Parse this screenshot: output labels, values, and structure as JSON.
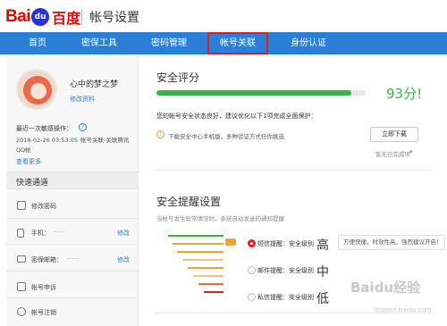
{
  "header": {
    "logo_latin": "Bai",
    "logo_paw": "du",
    "logo_cn": "百度",
    "title": "帐号设置"
  },
  "nav": {
    "items": [
      "首页",
      "密保工具",
      "密码管理",
      "帐号关联",
      "身份认证"
    ],
    "active": "帐号关联"
  },
  "profile": {
    "username": "心中的梦之梦",
    "edit_link": "修改资料"
  },
  "last_op": {
    "title": "最近一次敏感操作：",
    "help": "?",
    "time": "2018-02-26 03:53:05",
    "action": "帐号关联-关联腾讯",
    "action_cont": "QQ帐",
    "view_more": "查看更多"
  },
  "quick": {
    "title": "快速通道",
    "items": [
      {
        "label": "修改密码"
      },
      {
        "label": "手机：",
        "masked": "···  ···  ··",
        "link": "修改"
      },
      {
        "label": "密保邮箱：",
        "masked": "···  ···  ··",
        "link": "修改"
      },
      {
        "label": "帐号申诉"
      },
      {
        "label": "帐号注销"
      }
    ]
  },
  "security": {
    "title": "安全评分",
    "score": "93分!",
    "score_fraction": 0.93,
    "status_text": "您的帐号安全状态良好，建议优化以下1项完成全面保护：",
    "tip_icon": "!",
    "tip_text": "下载安全中心手机版，多种验证方式任你挑选",
    "download_btn": "立即下载",
    "done_link": "暂无已完成项",
    "done_arrow": "▾"
  },
  "reminder": {
    "title": "安全提醒设置",
    "subtitle": "当帐号发生异常情况时，系统自动发送的通知提醒",
    "options": [
      {
        "label": "短信提醒：安全级别",
        "level": "高",
        "selected": true
      },
      {
        "label": "邮件提醒：安全级别",
        "level": "中",
        "selected": false
      },
      {
        "label": "私信提醒：安全级别",
        "level": "低",
        "selected": false
      }
    ],
    "bubble": "方便快捷，时效性高，强烈建议开启！"
  },
  "watermark": {
    "text": "Baidu经验",
    "url": "jingyan.baidu.com"
  },
  "colors": {
    "brand_red": "#e10601",
    "nav_blue": "#2b7fd6",
    "score_green": "#3cb34a",
    "highlight_red": "#e0201b"
  }
}
